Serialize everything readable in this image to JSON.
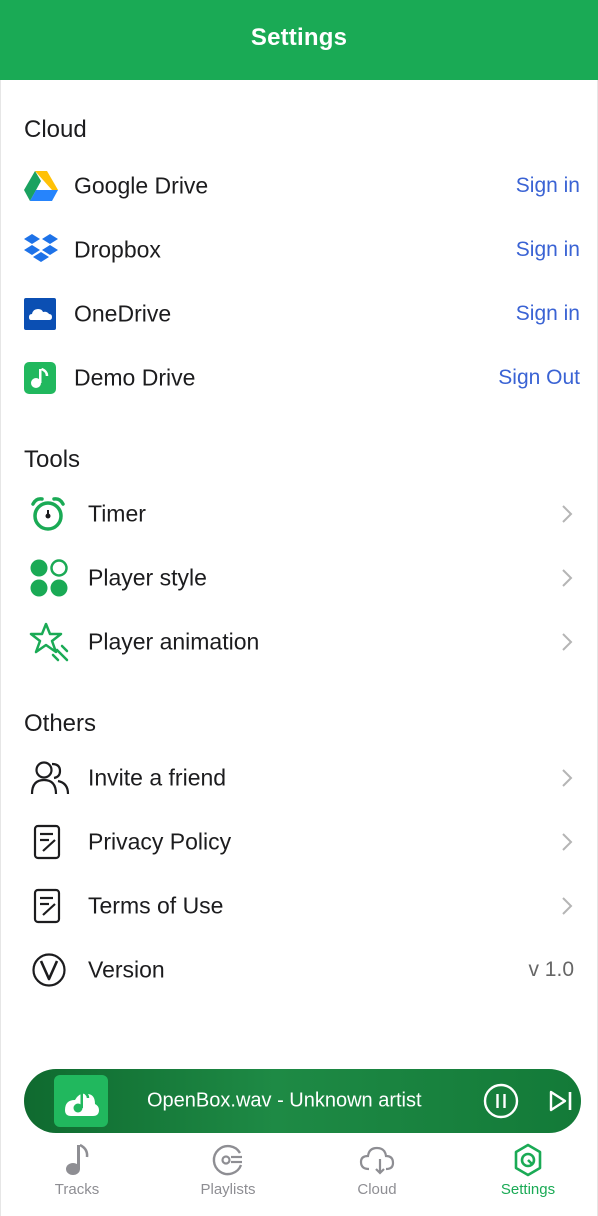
{
  "header": {
    "title": "Settings"
  },
  "sections": {
    "cloud": {
      "title": "Cloud",
      "items": [
        {
          "label": "Google Drive",
          "action": "Sign in",
          "icon": "google-drive-icon"
        },
        {
          "label": "Dropbox",
          "action": "Sign in",
          "icon": "dropbox-icon"
        },
        {
          "label": "OneDrive",
          "action": "Sign in",
          "icon": "onedrive-icon"
        },
        {
          "label": "Demo Drive",
          "action": "Sign Out",
          "icon": "demo-drive-icon"
        }
      ]
    },
    "tools": {
      "title": "Tools",
      "items": [
        {
          "label": "Timer",
          "icon": "alarm-clock-icon"
        },
        {
          "label": "Player style",
          "icon": "clover-icon"
        },
        {
          "label": "Player animation",
          "icon": "sparkle-star-icon"
        }
      ]
    },
    "others": {
      "title": "Others",
      "items": [
        {
          "label": "Invite a friend",
          "icon": "people-icon"
        },
        {
          "label": "Privacy Policy",
          "icon": "document-edit-icon"
        },
        {
          "label": "Terms of Use",
          "icon": "document-edit-icon"
        },
        {
          "label": "Version",
          "value": "v 1.0",
          "icon": "version-v-icon"
        }
      ]
    }
  },
  "player": {
    "title": "OpenBox.wav - Unknown artist"
  },
  "tabs": [
    {
      "label": "Tracks",
      "active": false
    },
    {
      "label": "Playlists",
      "active": false
    },
    {
      "label": "Cloud",
      "active": false
    },
    {
      "label": "Settings",
      "active": true
    }
  ],
  "colors": {
    "brand_green": "#1aaa55",
    "link_blue": "#3a63d4",
    "inactive_gray": "#8e8e93"
  }
}
